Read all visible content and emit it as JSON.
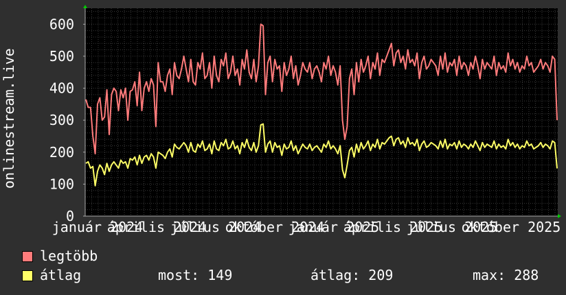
{
  "colors": {
    "background": "#2f2f2f",
    "plot_background": "#000000",
    "grid": "#3a3a3a",
    "legtobb": "#ff7b7b",
    "atlag": "#ffff66",
    "axis_arrow": "#00cc00",
    "text": "#ffffff"
  },
  "legend": {
    "max_label": "legtöbb",
    "avg_label": "átlag",
    "now": "most: 149",
    "avg": "átlag: 209",
    "max": "max: 288"
  },
  "chart_data": {
    "type": "line",
    "ylabel": "onlinestream.live",
    "ylim": [
      0,
      650
    ],
    "yticks": [
      0,
      100,
      200,
      300,
      400,
      500,
      600
    ],
    "x_tick_labels": [
      "január 2024",
      "április 2024",
      "július 2024",
      "október 2024",
      "január 2025",
      "április 2025",
      "július 2025",
      "október 2025"
    ],
    "grid": true,
    "legend_position": "bottom",
    "series": [
      {
        "name": "legtöbb",
        "color": "#ff7b7b",
        "values": [
          365,
          340,
          340,
          250,
          195,
          350,
          370,
          300,
          310,
          395,
          255,
          380,
          400,
          390,
          330,
          395,
          370,
          400,
          300,
          390,
          395,
          420,
          345,
          450,
          330,
          400,
          420,
          390,
          430,
          410,
          280,
          480,
          420,
          420,
          390,
          440,
          460,
          380,
          480,
          440,
          430,
          460,
          500,
          460,
          420,
          490,
          420,
          410,
          480,
          460,
          510,
          430,
          440,
          480,
          400,
          500,
          440,
          420,
          490,
          470,
          510,
          430,
          450,
          500,
          440,
          460,
          410,
          490,
          460,
          520,
          450,
          430,
          490,
          420,
          470,
          600,
          595,
          380,
          480,
          500,
          420,
          490,
          460,
          470,
          390,
          480,
          440,
          460,
          500,
          430,
          470,
          410,
          440,
          480,
          460,
          450,
          480,
          430,
          460,
          470,
          450,
          420,
          480,
          460,
          500,
          440,
          470,
          450,
          410,
          470,
          300,
          240,
          280,
          430,
          460,
          380,
          480,
          420,
          490,
          450,
          470,
          500,
          430,
          480,
          460,
          510,
          440,
          490,
          480,
          500,
          520,
          540,
          470,
          510,
          520,
          480,
          500,
          460,
          520,
          480,
          490,
          470,
          510,
          430,
          480,
          500,
          460,
          470,
          490,
          480,
          470,
          440,
          500,
          460,
          510,
          450,
          480,
          470,
          490,
          440,
          500,
          460,
          480,
          470,
          440,
          480,
          460,
          500,
          470,
          430,
          490,
          460,
          480,
          470,
          460,
          500,
          440,
          480,
          460,
          470,
          450,
          510,
          470,
          490,
          460,
          480,
          450,
          470,
          460,
          500,
          470,
          480,
          450,
          460,
          470,
          490,
          460,
          480,
          470,
          450,
          500,
          490,
          300
        ]
      },
      {
        "name": "átlag",
        "color": "#ffff66",
        "values": [
          165,
          170,
          150,
          155,
          95,
          140,
          160,
          150,
          130,
          165,
          140,
          160,
          170,
          160,
          150,
          175,
          165,
          170,
          150,
          180,
          175,
          185,
          160,
          190,
          165,
          185,
          190,
          175,
          195,
          185,
          150,
          200,
          195,
          190,
          180,
          200,
          210,
          185,
          225,
          215,
          210,
          220,
          230,
          220,
          200,
          230,
          205,
          200,
          225,
          215,
          235,
          205,
          210,
          225,
          195,
          235,
          210,
          205,
          230,
          220,
          240,
          210,
          215,
          235,
          210,
          220,
          195,
          230,
          215,
          240,
          215,
          205,
          230,
          200,
          220,
          285,
          288,
          200,
          225,
          235,
          200,
          230,
          215,
          220,
          190,
          225,
          210,
          215,
          235,
          205,
          220,
          195,
          210,
          225,
          215,
          210,
          225,
          205,
          215,
          220,
          210,
          200,
          225,
          215,
          235,
          210,
          220,
          210,
          195,
          220,
          145,
          120,
          160,
          205,
          215,
          185,
          225,
          200,
          230,
          210,
          220,
          235,
          205,
          225,
          215,
          240,
          210,
          230,
          225,
          235,
          245,
          250,
          220,
          240,
          245,
          225,
          235,
          215,
          245,
          225,
          230,
          220,
          240,
          205,
          225,
          235,
          215,
          220,
          230,
          225,
          220,
          210,
          235,
          215,
          240,
          210,
          225,
          220,
          230,
          210,
          235,
          215,
          225,
          220,
          210,
          225,
          215,
          235,
          220,
          205,
          230,
          215,
          225,
          220,
          215,
          235,
          210,
          225,
          215,
          220,
          210,
          240,
          220,
          230,
          215,
          225,
          210,
          220,
          215,
          235,
          220,
          225,
          210,
          215,
          220,
          230,
          215,
          225,
          220,
          210,
          235,
          230,
          149
        ]
      }
    ]
  }
}
